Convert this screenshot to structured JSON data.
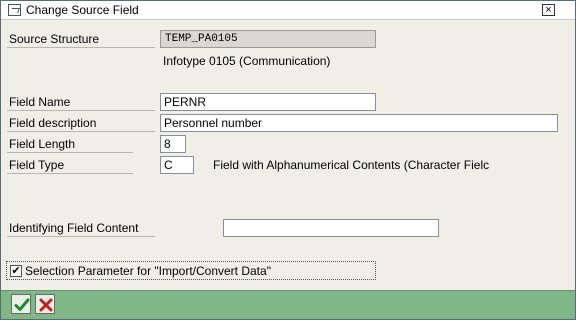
{
  "window": {
    "title": "Change Source Field",
    "close_glyph": "×"
  },
  "form": {
    "source_structure": {
      "label": "Source Structure",
      "value": "TEMP_PA0105",
      "description": "Infotype 0105 (Communication)"
    },
    "field_name": {
      "label": "Field Name",
      "value": "PERNR"
    },
    "field_description": {
      "label": "Field description",
      "value": "Personnel number"
    },
    "field_length": {
      "label": "Field Length",
      "value": "8"
    },
    "field_type": {
      "label": "Field Type",
      "value": "C",
      "description": "Field with Alphanumerical Contents (Character Fielc"
    },
    "identifying_content": {
      "label": "Identifying Field Content",
      "value": ""
    }
  },
  "selection_parameter": {
    "label": "Selection Parameter for \"Import/Convert Data\"",
    "checked": true,
    "check_glyph": "✔"
  },
  "footer": {
    "buttons": [
      {
        "name": "confirm",
        "icon": "checkmark-icon",
        "color": "#1f8a2b"
      },
      {
        "name": "cancel",
        "icon": "cancel-x-icon",
        "color": "#c81e1e"
      }
    ]
  }
}
